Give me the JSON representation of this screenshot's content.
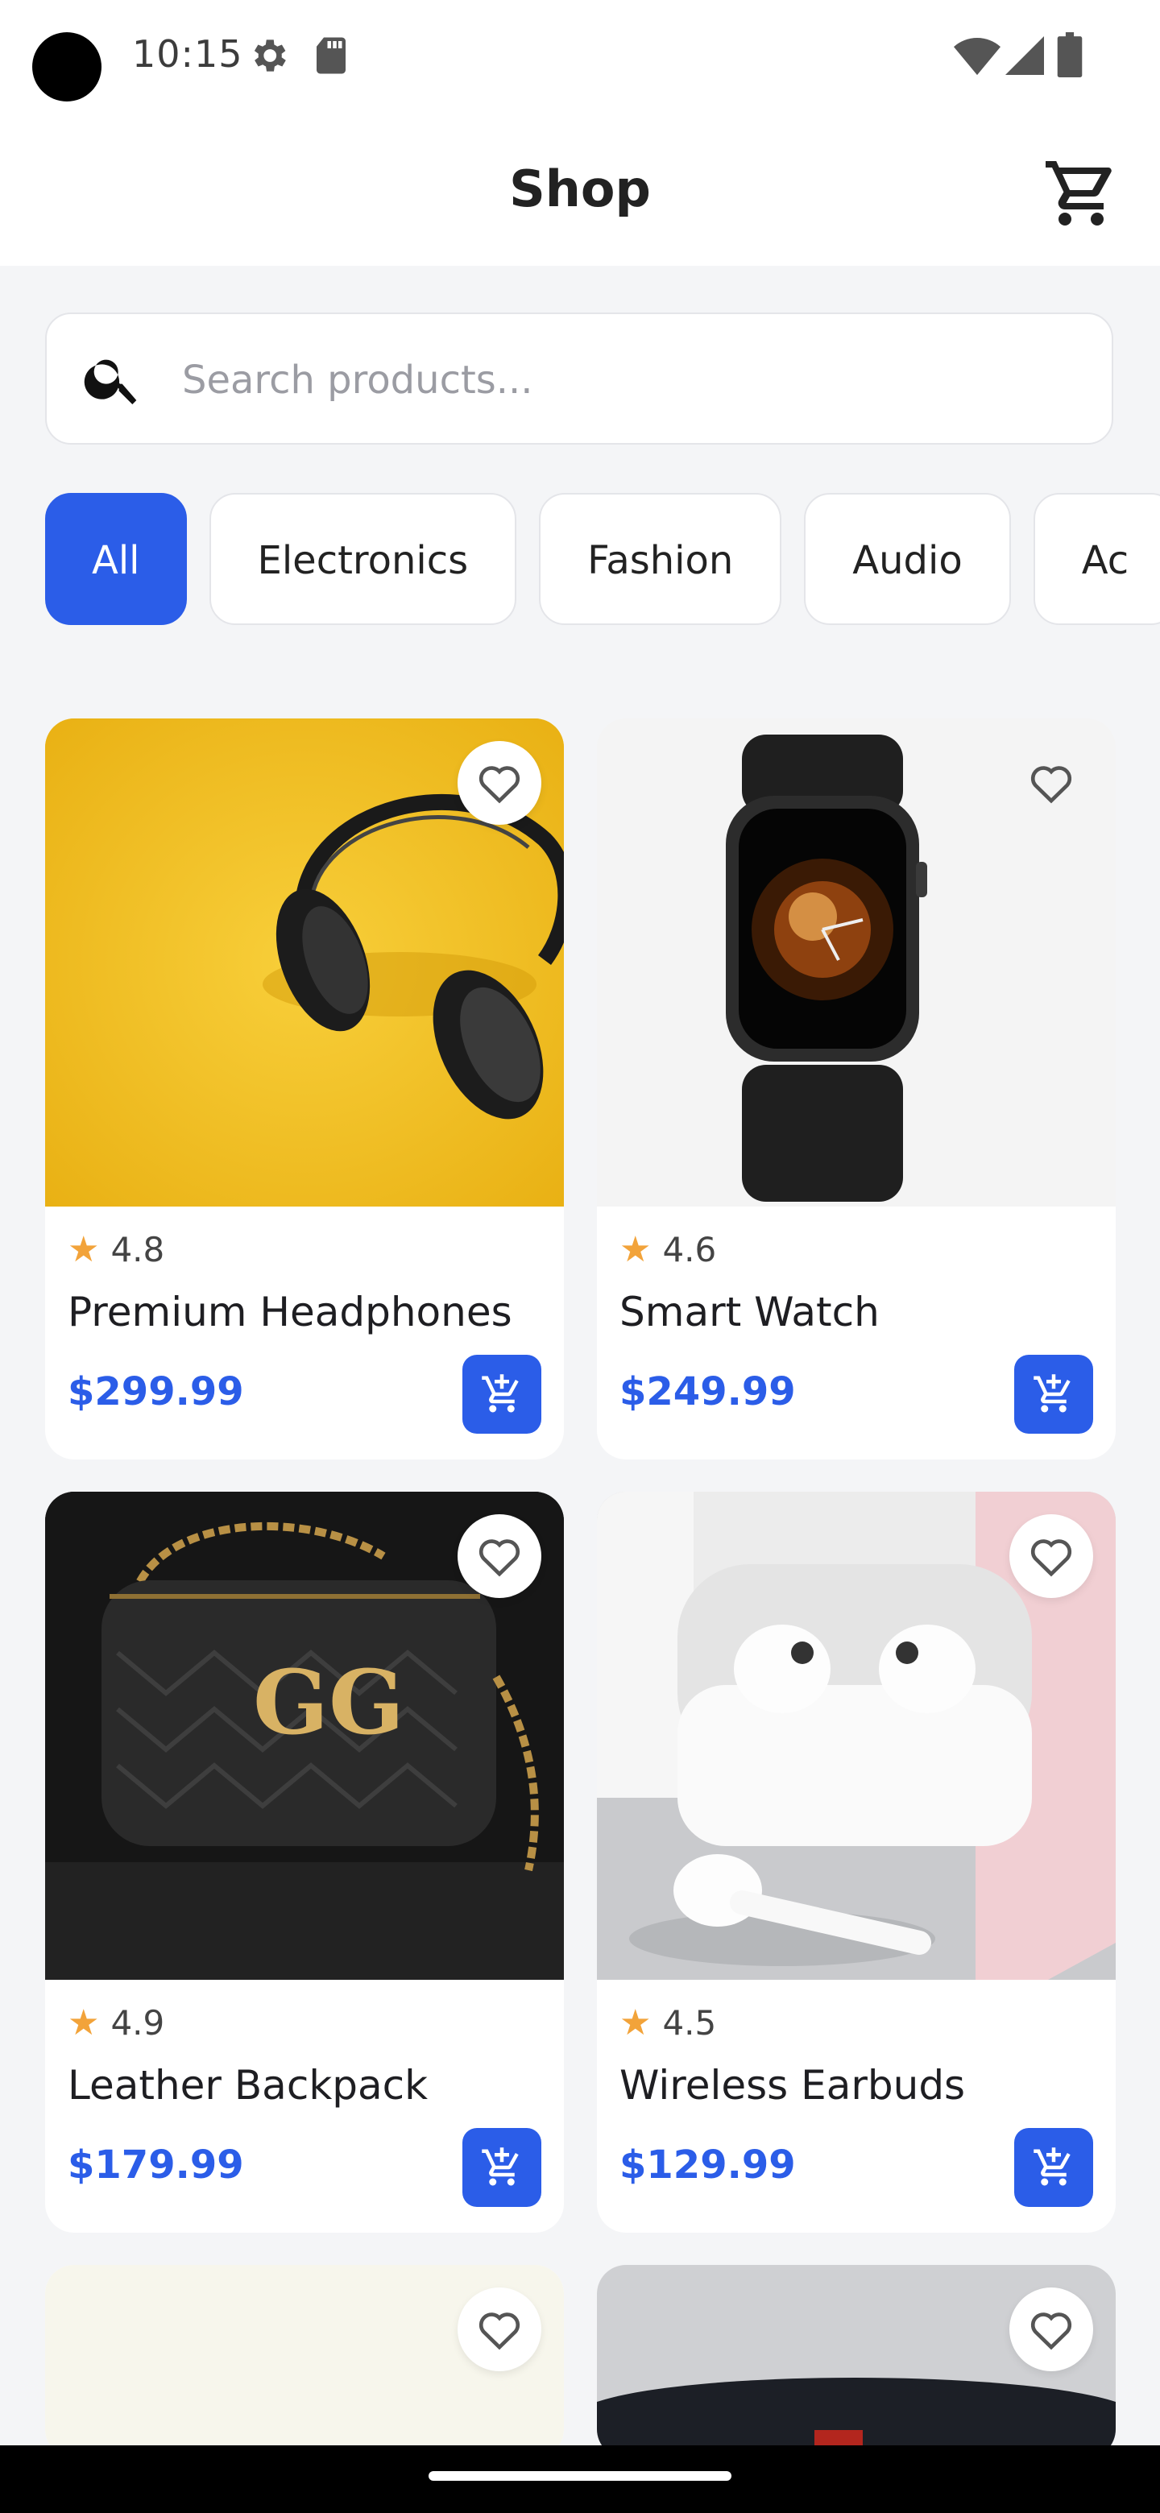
{
  "status_bar": {
    "time": "10:15"
  },
  "app_bar": {
    "title": "Shop"
  },
  "search": {
    "placeholder": "Search products..."
  },
  "categories": [
    "All",
    "Electronics",
    "Fashion",
    "Audio",
    "Ac"
  ],
  "products": [
    {
      "name": "Premium Headphones",
      "rating": "4.8",
      "price": "$299.99",
      "image": "headphones on yellow background"
    },
    {
      "name": "Smart Watch",
      "rating": "4.6",
      "price": "$249.99",
      "image": "black smart watch"
    },
    {
      "name": "Leather Backpack",
      "rating": "4.9",
      "price": "$179.99",
      "image": "black quilted leather bag"
    },
    {
      "name": "Wireless Earbuds",
      "rating": "4.5",
      "price": "$129.99",
      "image": "white wireless earbuds in case"
    }
  ],
  "colors": {
    "accent": "#2b5de8",
    "star": "#f2a33a",
    "background": "#f4f5f7"
  },
  "icons": [
    "cart-icon",
    "search-icon",
    "heart-icon",
    "star-icon",
    "add-to-cart-icon",
    "settings-icon",
    "sd-card-icon",
    "wifi-icon",
    "signal-icon",
    "battery-icon"
  ]
}
